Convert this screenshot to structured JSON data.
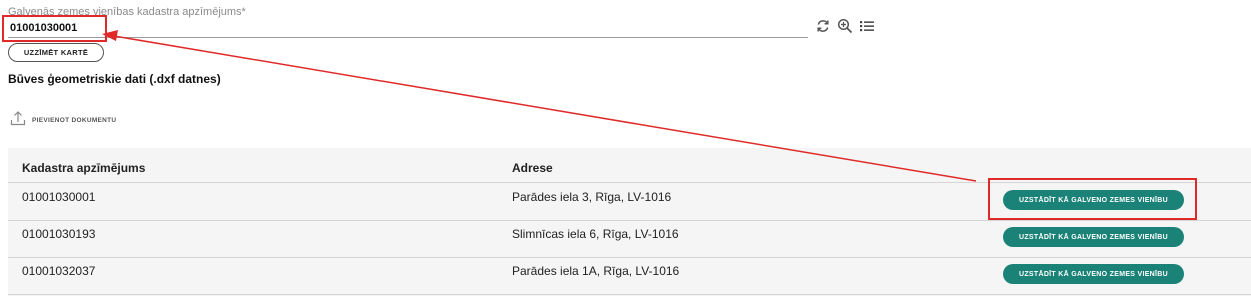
{
  "field": {
    "label": "Galvenās zemes vienības kadastra apzīmējums*",
    "value": "01001030001"
  },
  "icons": {
    "refresh": "refresh-icon",
    "zoom": "zoom-in-icon",
    "list": "list-icon"
  },
  "show_on_map_label": "UZZĪMĒT KARTĒ",
  "section_title": "Būves ģeometriskie dati (.dxf datnes)",
  "upload_label": "PIEVIENOT DOKUMENTU",
  "table": {
    "headers": [
      "Kadastra apzīmējums",
      "Adrese"
    ],
    "rows": [
      {
        "code": "01001030001",
        "address": "Parādes iela 3, Rīga, LV-1016",
        "action": "UZSTĀDĪT KĀ GALVENO ZEMES VIENĪBU"
      },
      {
        "code": "01001030193",
        "address": "Slimnīcas iela 6, Rīga, LV-1016",
        "action": "UZSTĀDĪT KĀ GALVENO ZEMES VIENĪBU"
      },
      {
        "code": "01001032037",
        "address": "Parādes iela 1A, Rīga, LV-1016",
        "action": "UZSTĀDĪT KĀ GALVENO ZEMES VIENĪBU"
      }
    ]
  },
  "colors": {
    "accent": "#1b8277",
    "annotation": "#e02a2a"
  }
}
